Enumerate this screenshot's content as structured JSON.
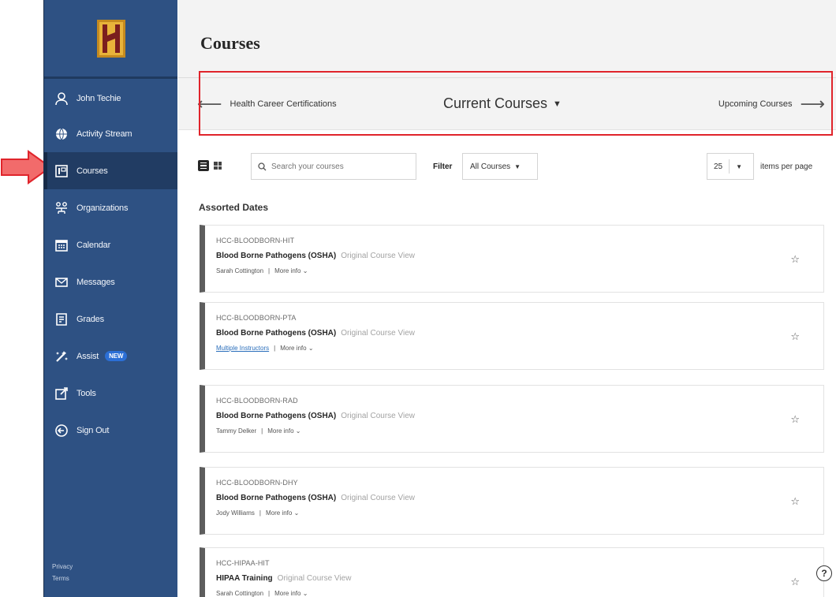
{
  "sidebar": {
    "items": [
      {
        "label": "John Techie",
        "icon": "user-icon"
      },
      {
        "label": "Activity Stream",
        "icon": "globe-icon"
      },
      {
        "label": "Courses",
        "icon": "courses-icon"
      },
      {
        "label": "Organizations",
        "icon": "organizations-icon"
      },
      {
        "label": "Calendar",
        "icon": "calendar-icon"
      },
      {
        "label": "Messages",
        "icon": "envelope-icon"
      },
      {
        "label": "Grades",
        "icon": "grades-icon"
      },
      {
        "label": "Assist",
        "icon": "assist-icon",
        "badge": "NEW"
      },
      {
        "label": "Tools",
        "icon": "tools-icon"
      },
      {
        "label": "Sign Out",
        "icon": "sign-out-icon"
      }
    ],
    "active": "Courses",
    "footer": {
      "privacy": "Privacy",
      "terms": "Terms"
    }
  },
  "header": {
    "title": "Courses"
  },
  "term_nav": {
    "previous": "Health Career Certifications",
    "current": "Current Courses",
    "next": "Upcoming Courses"
  },
  "toolbar": {
    "search_placeholder": "Search your courses",
    "filter_label": "Filter",
    "filter_value": "All Courses",
    "per_page_value": "25",
    "per_page_label": "items per page"
  },
  "group_title": "Assorted Dates",
  "courses": [
    {
      "code": "HCC-BLOODBORN-HIT",
      "title": "Blood Borne Pathogens (OSHA)",
      "view": "Original Course View",
      "instructor": "Sarah Cottington",
      "more": "More info"
    },
    {
      "code": "HCC-BLOODBORN-PTA",
      "title": "Blood Borne Pathogens (OSHA)",
      "view": "Original Course View",
      "instructor": "Multiple Instructors",
      "more": "More info"
    },
    {
      "code": "HCC-BLOODBORN-RAD",
      "title": "Blood Borne Pathogens (OSHA)",
      "view": "Original Course View",
      "instructor": "Tammy Delker",
      "more": "More info"
    },
    {
      "code": "HCC-BLOODBORN-DHY",
      "title": "Blood Borne Pathogens (OSHA)",
      "view": "Original Course View",
      "instructor": "Jody Williams",
      "more": "More info"
    },
    {
      "code": "HCC-HIPAA-HIT",
      "title": "HIPAA Training",
      "view": "Original Course View",
      "instructor": "Sarah Cottington",
      "more": "More info"
    }
  ],
  "colors": {
    "sidebar": "#2e5183",
    "sidebar_active": "#213c63",
    "annotation": "#e0242b",
    "link": "#2a6ebb",
    "card_accent": "#5d5d5d"
  }
}
